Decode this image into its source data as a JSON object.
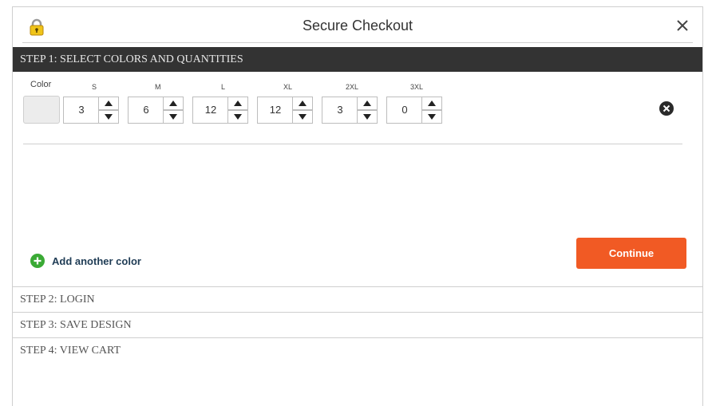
{
  "header": {
    "title": "Secure Checkout"
  },
  "steps": [
    {
      "label": "STEP 1: SELECT COLORS AND QUANTITIES",
      "active": true
    },
    {
      "label": "STEP 2: LOGIN",
      "active": false
    },
    {
      "label": "STEP 3: SAVE DESIGN",
      "active": false
    },
    {
      "label": "STEP 4: VIEW CART",
      "active": false
    }
  ],
  "color_column": {
    "label": "Color",
    "swatch": "#ececec"
  },
  "sizes": [
    {
      "label": "S",
      "value": "3"
    },
    {
      "label": "M",
      "value": "6"
    },
    {
      "label": "L",
      "value": "12"
    },
    {
      "label": "XL",
      "value": "12"
    },
    {
      "label": "2XL",
      "value": "3"
    },
    {
      "label": "3XL",
      "value": "0"
    }
  ],
  "actions": {
    "add_color_label": "Add another color",
    "continue_label": "Continue"
  },
  "colors": {
    "accent": "#f15a24",
    "header_bar": "#333333",
    "add_icon": "#3aaa35"
  },
  "icons": {
    "lock": "lock-icon",
    "close": "close-icon",
    "remove": "remove-icon",
    "add": "plus-circle-icon",
    "up": "chevron-up-icon",
    "down": "chevron-down-icon"
  }
}
